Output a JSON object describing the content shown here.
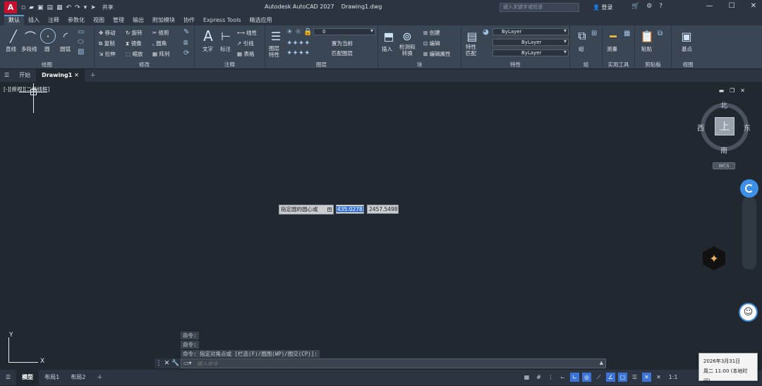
{
  "app": {
    "logo_letter": "A",
    "share": "共享",
    "window_title": "Autodesk AutoCAD 2027    Drawing1.dwg"
  },
  "search": {
    "placeholder": "键入关键字或短语"
  },
  "login": "登录",
  "ribbon_tabs": [
    "默认",
    "插入",
    "注释",
    "参数化",
    "视图",
    "管理",
    "输出",
    "附加模块",
    "协作",
    "Express Tools",
    "精选应用"
  ],
  "ribbon": {
    "draw": {
      "title": "绘图",
      "line": "直线",
      "polyline": "多段线",
      "circle": "圆",
      "arc": "圆弧"
    },
    "modify": {
      "title": "修改",
      "move": "移动",
      "rotate": "旋转",
      "trim": "修剪",
      "copy": "复制",
      "mirror": "镜像",
      "fillet": "圆角",
      "stretch": "拉伸",
      "scale": "缩放",
      "array": "阵列"
    },
    "annotation": {
      "title": "注释",
      "text": "文字",
      "dimension": "标注",
      "linear": "线性",
      "leader": "引线",
      "table": "表格"
    },
    "layers": {
      "title": "图层",
      "layer_props": "图层\n特性",
      "layer_value": "0",
      "set_current": "置为当前",
      "match_layer": "匹配图层"
    },
    "block": {
      "title": "块",
      "insert": "插入",
      "detect": "检测和\n转换",
      "create": "创建",
      "edit": "编辑",
      "edit_attr": "编辑属性"
    },
    "properties": {
      "title": "特性",
      "match": "特性\n匹配",
      "bylayer": "ByLayer"
    },
    "groups": {
      "title": "组",
      "group": "组"
    },
    "utilities": {
      "title": "实用工具",
      "measure": "测量"
    },
    "clipboard": {
      "title": "剪贴板",
      "paste": "粘贴"
    },
    "view": {
      "title": "视图",
      "base": "基点"
    }
  },
  "file_tabs": {
    "start": "开始",
    "drawing": "Drawing1"
  },
  "viewport": {
    "label": "[-][俯视][二维线框]"
  },
  "viewcube": {
    "north": "北",
    "south": "南",
    "east": "东",
    "west": "西",
    "top": "上",
    "wcs": "WCS"
  },
  "dynamic_input": {
    "prompt": "指定圆的圆心或",
    "x": "435.0278",
    "y": "2457.5498"
  },
  "ucs": {
    "x": "X",
    "y": "Y"
  },
  "command_history": [
    "命令:",
    "命令:",
    "命令: 指定对角点或 [栏选(F)/圈围(WP)/圈交(CP)]:"
  ],
  "command_line": {
    "placeholder": "键入命令"
  },
  "layout_tabs": [
    "模型",
    "布局1",
    "布局2"
  ],
  "status": {
    "scale": "1:1"
  },
  "clock": {
    "date": "2026年3月31日",
    "time": "周二 11:00 (本地时间)"
  }
}
